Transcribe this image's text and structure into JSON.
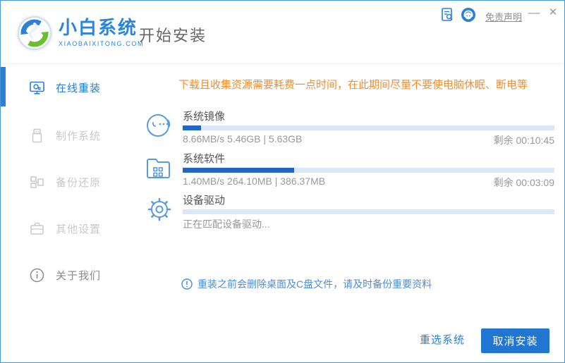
{
  "header": {
    "brand_title": "小白系统",
    "brand_subtitle": "XIAOBAIXITONG.COM",
    "page_title": "开始安装",
    "disclaimer_link": "免责声明",
    "minimize_glyph": "—",
    "close_glyph": "✕"
  },
  "sidebar": {
    "items": [
      {
        "label": "在线重装",
        "active": true
      },
      {
        "label": "制作系统",
        "active": false
      },
      {
        "label": "备份还原",
        "active": false
      },
      {
        "label": "其他设置",
        "active": false
      },
      {
        "label": "关于我们",
        "active": false
      }
    ]
  },
  "main": {
    "warning": "下载且收集资源需要耗费一点时间，在此期间尽量不要使电脑休眠、断电等",
    "tasks": [
      {
        "label": "系统镜像",
        "stats": "8.66MB/s 5.46GB | 5.63GB",
        "remaining": "剩余 00:10:45",
        "percent": 5
      },
      {
        "label": "系统软件",
        "stats": "1.40MB/s 264.10MB | 386.37MB",
        "remaining": "剩余 00:03:09",
        "percent": 30
      },
      {
        "label": "设备驱动",
        "stats": "正在匹配设备驱动...",
        "remaining": "",
        "percent": 0
      }
    ],
    "note": "重装之前会删除桌面及C盘文件，请及时备份重要资料"
  },
  "footer": {
    "reselect_label": "重选系统",
    "cancel_label": "取消安装"
  },
  "colors": {
    "accent": "#2b7fd8",
    "button": "#2176d2",
    "brand": "#2a86dd",
    "warning_text": "#ef8f2f",
    "note_text": "#4a8ed8",
    "progress_track": "#dce8f7",
    "progress_fill": "#2265c8",
    "window_border": "#4799d6"
  }
}
